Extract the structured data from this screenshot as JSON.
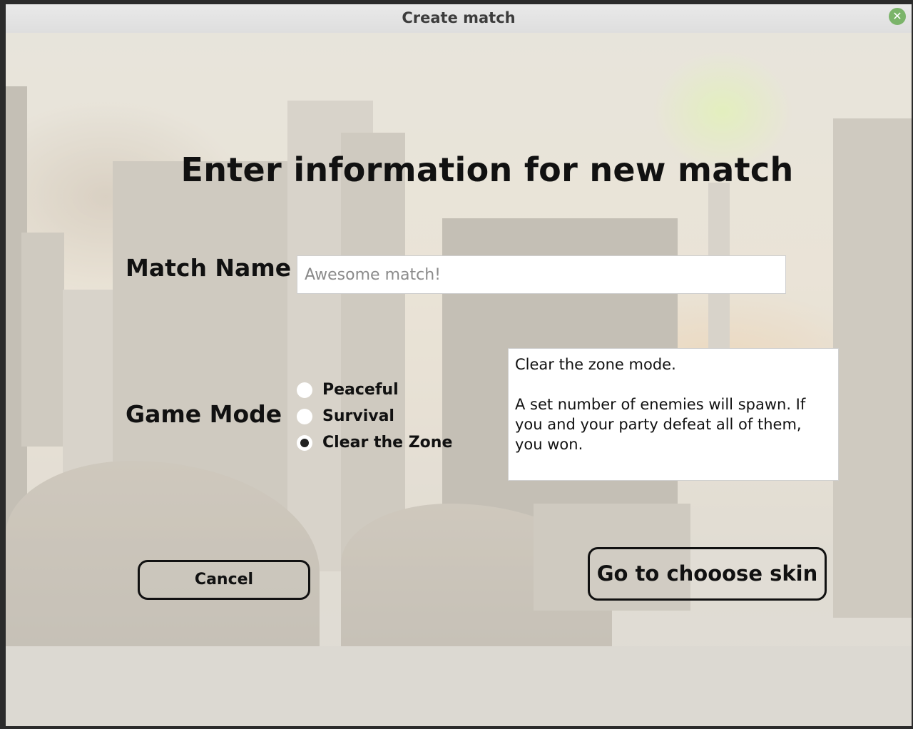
{
  "window": {
    "title": "Create match",
    "close_icon": "close-icon"
  },
  "form": {
    "heading": "Enter information for new match",
    "match_name_label": "Match Name",
    "match_name_placeholder": "Awesome match!",
    "match_name_value": "",
    "game_mode_label": "Game Mode",
    "game_modes": [
      {
        "label": "Peaceful",
        "checked": false
      },
      {
        "label": "Survival",
        "checked": false
      },
      {
        "label": "Clear the Zone",
        "checked": true
      }
    ],
    "mode_description": "Clear the zone mode.\n\nA set number of enemies will spawn. If you and your party defeat all of them, you won.",
    "cancel_label": "Cancel",
    "next_label": "Go to chooose skin"
  },
  "colors": {
    "accent_close": "#7bb46a",
    "text": "#111111"
  }
}
